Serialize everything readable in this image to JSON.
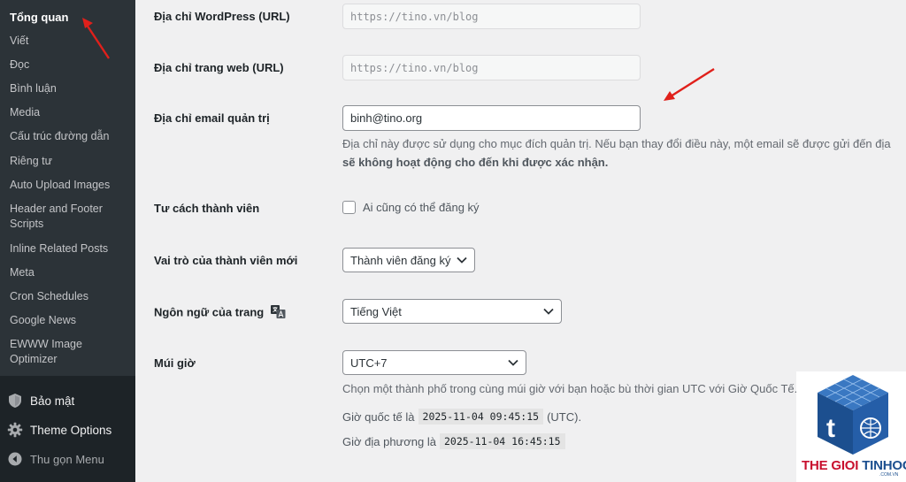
{
  "sidebar": {
    "submenu": [
      {
        "label": "Tổng quan",
        "current": true
      },
      {
        "label": "Viết"
      },
      {
        "label": "Đọc"
      },
      {
        "label": "Bình luận"
      },
      {
        "label": "Media"
      },
      {
        "label": "Cấu trúc đường dẫn"
      },
      {
        "label": "Riêng tư"
      },
      {
        "label": "Auto Upload Images"
      },
      {
        "label": "Header and Footer Scripts"
      },
      {
        "label": "Inline Related Posts"
      },
      {
        "label": "Meta"
      },
      {
        "label": "Cron Schedules"
      },
      {
        "label": "Google News"
      },
      {
        "label": "EWWW Image Optimizer"
      }
    ],
    "main": [
      {
        "label": "Bảo mật",
        "icon": "shield-icon"
      },
      {
        "label": "Theme Options",
        "icon": "gear-icon"
      },
      {
        "label": "Thu gọn Menu",
        "icon": "collapse-icon"
      }
    ]
  },
  "settings": {
    "wp_url": {
      "label": "Địa chỉ WordPress (URL)",
      "value": "https://tino.vn/blog"
    },
    "site_url": {
      "label": "Địa chỉ trang web (URL)",
      "value": "https://tino.vn/blog"
    },
    "admin_email": {
      "label": "Địa chỉ email quản trị",
      "value": "binh@tino.org",
      "desc_line1": "Địa chỉ này được sử dụng cho mục đích quản trị. Nếu bạn thay đổi điều này, một email sẽ được gửi đến địa",
      "desc_line2": "sẽ không hoạt động cho đến khi được xác nhận."
    },
    "membership": {
      "label": "Tư cách thành viên",
      "checkbox_label": "Ai cũng có thể đăng ký",
      "checked": false
    },
    "default_role": {
      "label": "Vai trò của thành viên mới",
      "value": "Thành viên đăng ký"
    },
    "language": {
      "label": "Ngôn ngữ của trang",
      "value": "Tiếng Việt"
    },
    "timezone": {
      "label": "Múi giờ",
      "value": "UTC+7",
      "desc": "Chọn một thành phố trong cùng múi giờ với bạn hoặc bù thời gian UTC với Giờ Quốc Tế.",
      "utc_prefix": "Giờ quốc tế là",
      "utc_time": "2025-11-04 09:45:15",
      "utc_suffix": "(UTC).",
      "local_prefix": "Giờ địa phương là",
      "local_time": "2025-11-04 16:45:15"
    }
  },
  "watermark": {
    "brand_red": "THE GIOI ",
    "brand_blue": "TINHOC",
    "sub": ".COM.VN"
  },
  "colors": {
    "sidebar": "#2c3338",
    "sidebar_dark": "#1d2327",
    "arrow": "#e0201b",
    "brand_red": "#c8102e",
    "brand_blue": "#1c4f8f"
  }
}
